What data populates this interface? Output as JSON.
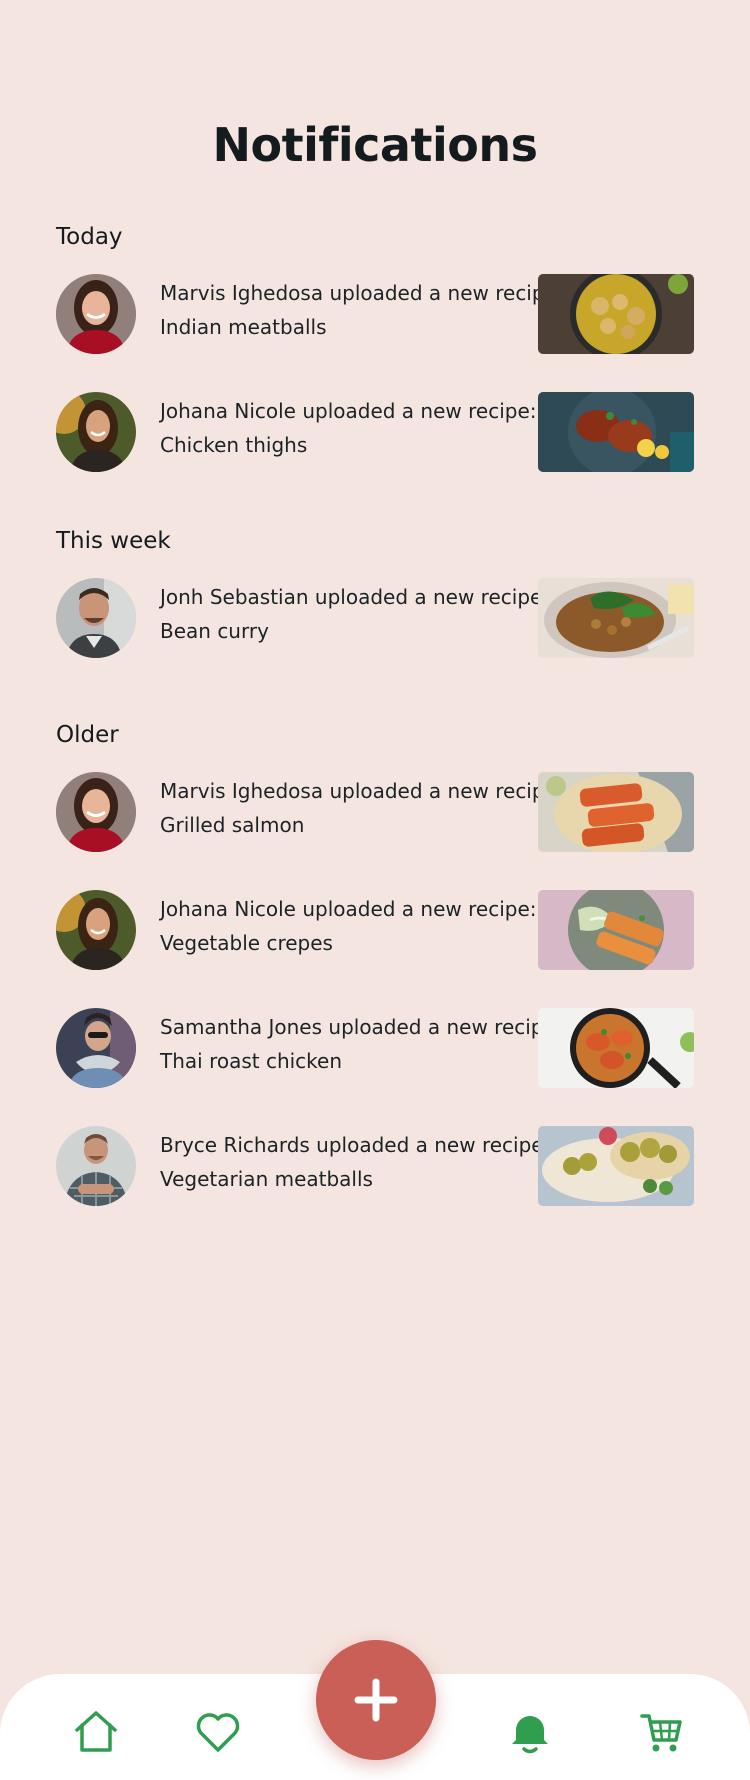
{
  "header": {
    "title": "Notifications"
  },
  "sections": [
    {
      "title": "Today",
      "items": [
        {
          "line1": "Marvis Ighedosa uploaded a new recipe:",
          "line2": "Indian meatballs",
          "avatar": "woman-red-top-avatar",
          "food": "indian-meatballs-photo"
        },
        {
          "line1": "Johana Nicole uploaded a new recipe:",
          "line2": "Chicken thighs",
          "avatar": "woman-sunset-avatar",
          "food": "chicken-thighs-photo"
        }
      ]
    },
    {
      "title": "This week",
      "items": [
        {
          "line1": "Jonh Sebastian uploaded a new recipe:",
          "line2": "Bean curry",
          "avatar": "man-smiling-avatar",
          "food": "bean-curry-photo"
        }
      ]
    },
    {
      "title": "Older",
      "items": [
        {
          "line1": "Marvis Ighedosa uploaded a new recipe:",
          "line2": "Grilled salmon",
          "avatar": "woman-red-top-avatar",
          "food": "grilled-salmon-photo"
        },
        {
          "line1": "Johana Nicole uploaded a new recipe:",
          "line2": "Vegetable crepes",
          "avatar": "woman-sunset-avatar",
          "food": "vegetable-crepes-photo"
        },
        {
          "line1": "Samantha Jones uploaded a new recipe:",
          "line2": "Thai roast chicken",
          "avatar": "woman-scarf-avatar",
          "food": "thai-roast-chicken-photo"
        },
        {
          "line1": "Bryce Richards uploaded a new recipe:",
          "line2": "Vegetarian meatballs",
          "avatar": "man-plaid-shirt-avatar",
          "food": "vegetarian-meatballs-photo"
        }
      ]
    }
  ],
  "bottom_nav": {
    "items": [
      {
        "icon": "home-icon"
      },
      {
        "icon": "heart-icon"
      },
      {
        "icon": "plus-icon"
      },
      {
        "icon": "bell-icon",
        "active": true
      },
      {
        "icon": "cart-icon"
      }
    ]
  },
  "colors": {
    "background": "#f5e5e0",
    "accent_green": "#2f9e4f",
    "fab": "#c95f56",
    "text": "#141b1e"
  }
}
